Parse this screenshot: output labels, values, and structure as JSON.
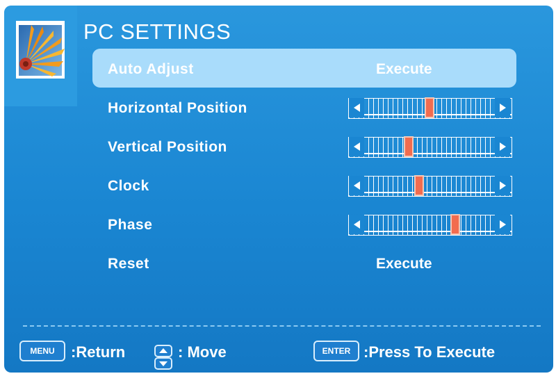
{
  "title": "PC SETTINGS",
  "menu": {
    "items": [
      {
        "label": "Auto Adjust",
        "type": "action",
        "value": "Execute",
        "selected": true
      },
      {
        "label": "Horizontal Position",
        "type": "slider",
        "level": 0.5
      },
      {
        "label": "Vertical Position",
        "type": "slider",
        "level": 0.34
      },
      {
        "label": "Clock",
        "type": "slider",
        "level": 0.42
      },
      {
        "label": "Phase",
        "type": "slider",
        "level": 0.7
      },
      {
        "label": "Reset",
        "type": "action",
        "value": "Execute"
      }
    ]
  },
  "footer": {
    "menu_key": "MENU",
    "menu_text": ":Return",
    "move_icon": "up-down-arrows-icon",
    "move_text": ": Move",
    "enter_key": "ENTER",
    "enter_text": ":Press To Execute"
  },
  "colors": {
    "background": "#1a86d2",
    "highlight": "#a9dcfb",
    "slider_thumb": "#f26c4f"
  }
}
